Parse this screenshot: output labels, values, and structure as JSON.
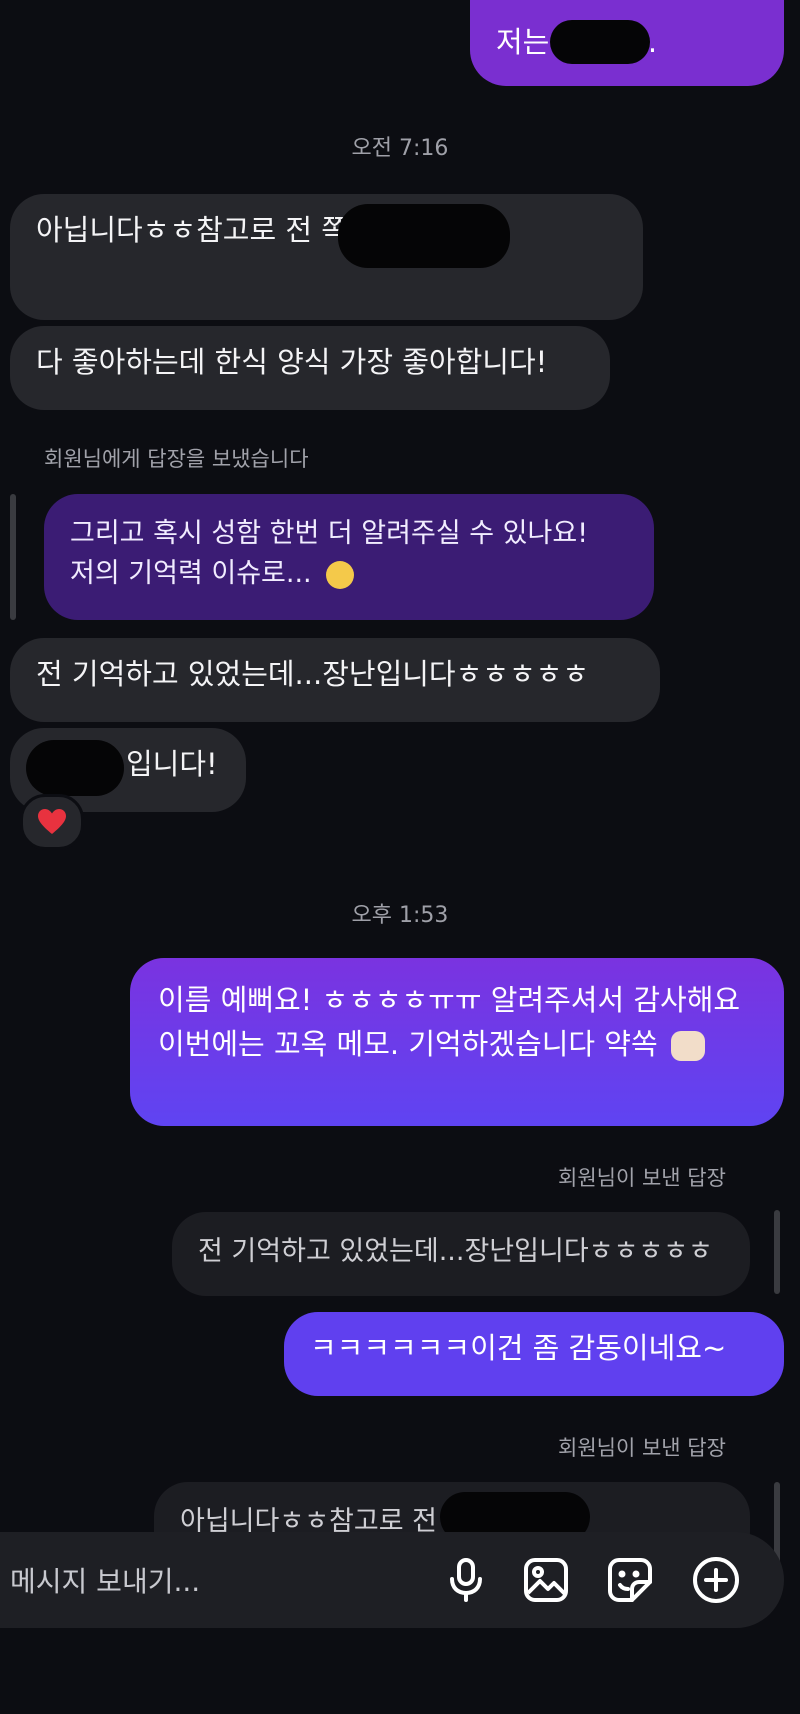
{
  "messages": {
    "top_out": "저는              이에요 .",
    "ts1": "오전 7:16",
    "in1": "아닙니다ㅎㅎ참고로 전                    쪽 살아요!",
    "in2": "다 좋아하는데 한식 양식 가장 좋아합니다!",
    "reply_notice_in": "회원님에게 답장을 보냈습니다",
    "reply_quote_in": "그리고 혹시 성함 한번 더 알려주실 수 있나요! 저의 기억력 이슈로...",
    "in3": "전 기억하고 있었는데...장난입니다ㅎㅎㅎㅎㅎ",
    "in4": "입니다!",
    "ts2": "오후 1:53",
    "out2": "이름 예뻐요! ㅎㅎㅎㅎㅠㅠ 알려주셔서 감사해요 이번에는 꼬옥 메모. 기억하겠습니다 약쏙",
    "reply_notice_out1": "회원님이 보낸 답장",
    "reply_quote_out1": "전 기억하고 있었는데...장난입니다ㅎㅎㅎㅎㅎ",
    "out3": "ㅋㅋㅋㅋㅋㅋ이건 좀 감동이네요~",
    "reply_notice_out2": "회원님이 보낸 답장",
    "reply_quote_out2": "아닙니다ㅎㅎ참고로 전                    쪽 살아요!"
  },
  "composer": {
    "placeholder": "메시지 보내기..."
  },
  "icons": {
    "mic": "microphone-icon",
    "gallery": "image-icon",
    "sticker": "sticker-icon",
    "add": "plus-circle-icon",
    "reaction": "heart-icon",
    "emoji1": "crying-face-icon",
    "emoji2": "fist-icon"
  },
  "colors": {
    "background": "#0c0d12",
    "incoming": "#26272c",
    "outgoing_purple": "#7a2fd0",
    "outgoing_violet": "#6a3ff0",
    "heart": "#e8323f"
  }
}
